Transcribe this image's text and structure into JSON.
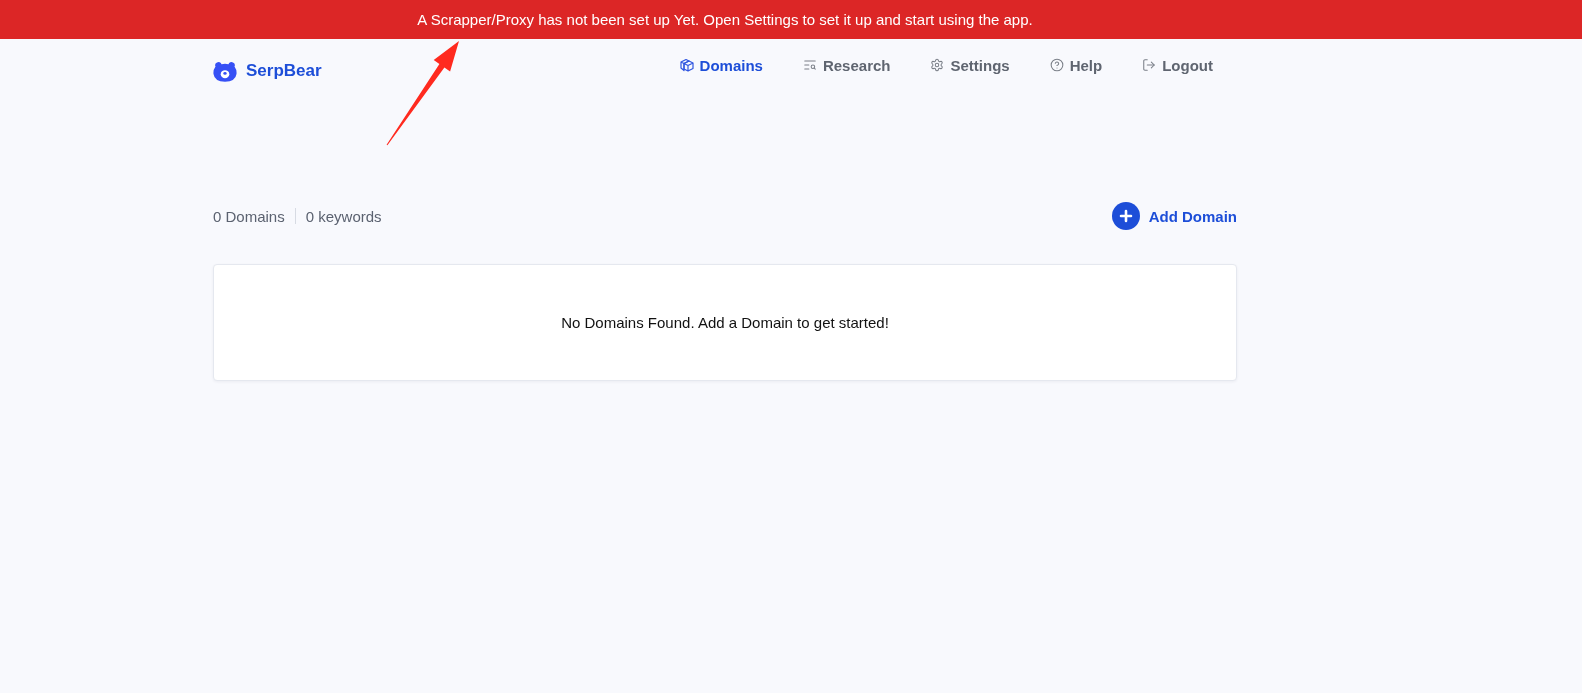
{
  "banner": {
    "message": "A Scrapper/Proxy has not been set up Yet. Open Settings to set it up and start using the app."
  },
  "header": {
    "logo": "SerpBear"
  },
  "nav": [
    {
      "label": "Domains",
      "kind": "domains",
      "selected": true
    },
    {
      "label": "Research",
      "kind": "research",
      "selected": false
    },
    {
      "label": "Settings",
      "kind": "settings",
      "selected": false
    },
    {
      "label": "Help",
      "kind": "help",
      "selected": false
    },
    {
      "label": "Logout",
      "kind": "logout",
      "selected": false
    }
  ],
  "stats": {
    "domains": "0 Domains",
    "keywords": "0 keywords"
  },
  "add_button": {
    "label": "Add Domain"
  },
  "empty_state": {
    "message": "No Domains Found. Add a Domain to get started!"
  }
}
